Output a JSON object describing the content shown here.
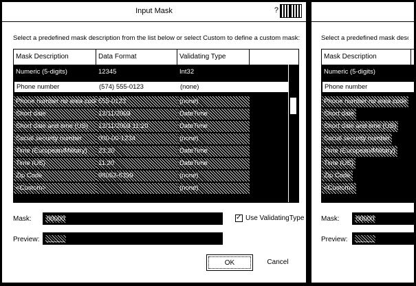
{
  "dialog": {
    "title": "Input Mask",
    "help_glyph": "?",
    "instruction": "Select a predefined mask description from the list below or select Custom to define a custom mask:",
    "columns": [
      "Mask Description",
      "Data Format",
      "Validating Type"
    ],
    "rows": [
      {
        "description": "Numeric (5-digits)",
        "format": "12345",
        "type": "Int32"
      },
      {
        "description": "Phone number",
        "format": "(574) 555-0123",
        "type": "(none)"
      },
      {
        "description": "Phone number no area code",
        "format": "555-0123",
        "type": "(none)"
      },
      {
        "description": "Short date",
        "format": "12/11/2003",
        "type": "DateTime"
      },
      {
        "description": "Short date and time (US)",
        "format": "12/11/2003 11:20",
        "type": "DateTime"
      },
      {
        "description": "Social security number",
        "format": "000-00-1234",
        "type": "(none)"
      },
      {
        "description": "Time (European/Military)",
        "format": "23:20",
        "type": "DateTime"
      },
      {
        "description": "Time (US)",
        "format": "11:20",
        "type": "DateTime"
      },
      {
        "description": "Zip Code",
        "format": "98052-6399",
        "type": "(none)"
      },
      {
        "description": "<Custom>",
        "format": "",
        "type": "(none)"
      }
    ],
    "selected_index": 0,
    "mask_label": "Mask:",
    "mask_value": "00000",
    "use_validating_type_label": "Use ValidatingType",
    "use_validating_type_checked": true,
    "preview_label": "Preview:",
    "preview_value": "_____",
    "ok_label": "OK",
    "cancel_label": "Cancel"
  },
  "second_dialog": {
    "instruction": "Select a predefined mask description from",
    "column": "Mask Description",
    "rows": [
      "Numeric (5-digits)",
      "Phone number",
      "Phone number no area code",
      "Short date",
      "Short date and time (US)",
      "Social security number",
      "Time (European/Military)",
      "Time (US)",
      "Zip Code",
      "<Custom>"
    ],
    "mask_label": "Mask:",
    "preview_label": "Preview:"
  }
}
